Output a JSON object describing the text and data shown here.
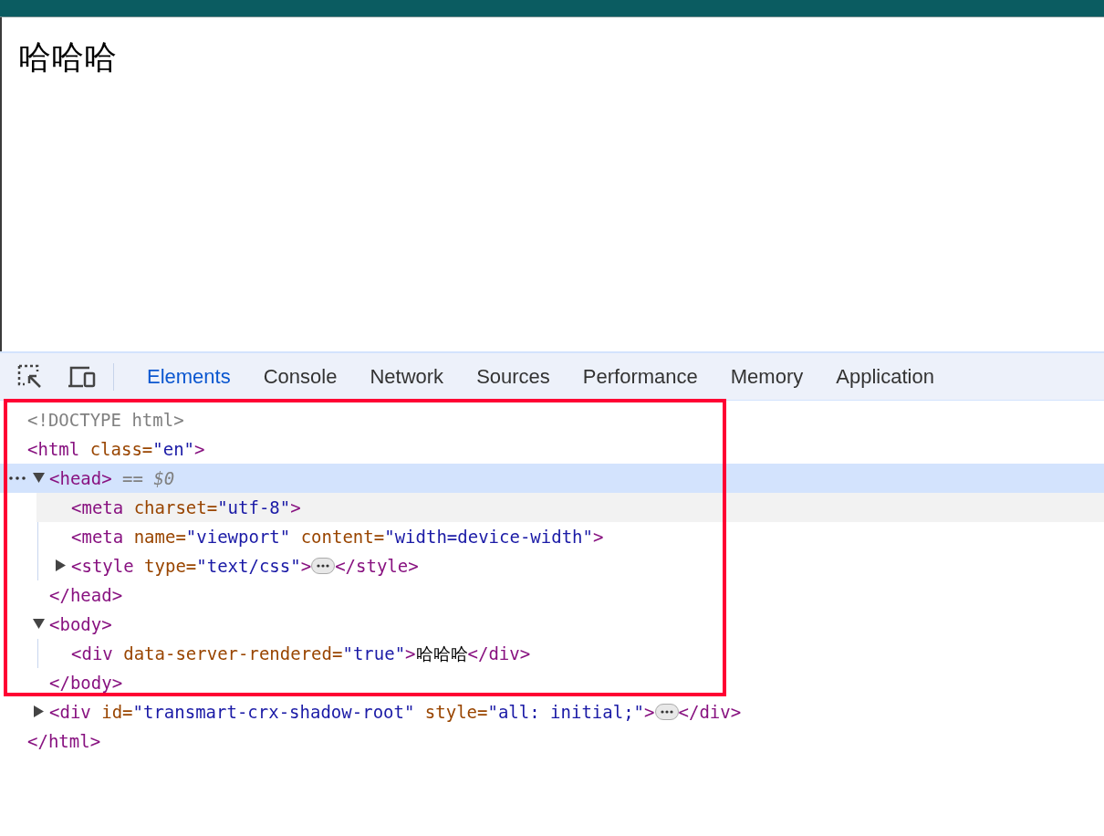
{
  "page": {
    "heading": "哈哈哈"
  },
  "devtools": {
    "tabs": [
      {
        "label": "Elements",
        "selected": true
      },
      {
        "label": "Console",
        "selected": false
      },
      {
        "label": "Network",
        "selected": false
      },
      {
        "label": "Sources",
        "selected": false
      },
      {
        "label": "Performance",
        "selected": false
      },
      {
        "label": "Memory",
        "selected": false
      },
      {
        "label": "Application",
        "selected": false
      }
    ],
    "tree": [
      {
        "selected": false,
        "hovered": false,
        "tokens": [
          {
            "kind": "doctype",
            "text": "<!DOCTYPE html>"
          }
        ]
      },
      {
        "selected": false,
        "hovered": false,
        "tokens": [
          {
            "kind": "tag",
            "text": "<html"
          },
          {
            "kind": "attr",
            "text": " class="
          },
          {
            "kind": "value",
            "text": "\"en\""
          },
          {
            "kind": "tag",
            "text": ">"
          }
        ],
        "closing": [
          {
            "kind": "tag",
            "text": "</html>"
          }
        ],
        "children": [
          {
            "selected": true,
            "hovered": false,
            "expanded": true,
            "tokens": [
              {
                "kind": "tag",
                "text": "<head>"
              },
              {
                "kind": "marker",
                "text": " == $0"
              }
            ],
            "closing": [
              {
                "kind": "tag",
                "text": "</head>"
              }
            ],
            "children": [
              {
                "selected": false,
                "hovered": true,
                "tokens": [
                  {
                    "kind": "tag",
                    "text": "<meta"
                  },
                  {
                    "kind": "attr",
                    "text": " charset="
                  },
                  {
                    "kind": "value",
                    "text": "\"utf-8\""
                  },
                  {
                    "kind": "tag",
                    "text": ">"
                  }
                ]
              },
              {
                "selected": false,
                "hovered": false,
                "tokens": [
                  {
                    "kind": "tag",
                    "text": "<meta"
                  },
                  {
                    "kind": "attr",
                    "text": " name="
                  },
                  {
                    "kind": "value",
                    "text": "\"viewport\""
                  },
                  {
                    "kind": "attr",
                    "text": " content="
                  },
                  {
                    "kind": "value",
                    "text": "\"width=device-width\""
                  },
                  {
                    "kind": "tag",
                    "text": ">"
                  }
                ]
              },
              {
                "selected": false,
                "hovered": false,
                "expanded": false,
                "tokens": [
                  {
                    "kind": "tag",
                    "text": "<style"
                  },
                  {
                    "kind": "attr",
                    "text": " type="
                  },
                  {
                    "kind": "value",
                    "text": "\"text/css\""
                  },
                  {
                    "kind": "tag",
                    "text": ">"
                  },
                  {
                    "kind": "ellipsis"
                  },
                  {
                    "kind": "tag",
                    "text": "</style>"
                  }
                ]
              }
            ]
          },
          {
            "selected": false,
            "hovered": false,
            "expanded": true,
            "tokens": [
              {
                "kind": "tag",
                "text": "<body>"
              }
            ],
            "closing": [
              {
                "kind": "tag",
                "text": "</body>"
              }
            ],
            "children": [
              {
                "selected": false,
                "hovered": false,
                "tokens": [
                  {
                    "kind": "tag",
                    "text": "<div"
                  },
                  {
                    "kind": "attr",
                    "text": " data-server-rendered="
                  },
                  {
                    "kind": "value",
                    "text": "\"true\""
                  },
                  {
                    "kind": "tag",
                    "text": ">"
                  },
                  {
                    "kind": "text",
                    "text": "哈哈哈"
                  },
                  {
                    "kind": "tag",
                    "text": "</div>"
                  }
                ]
              }
            ]
          },
          {
            "selected": false,
            "hovered": false,
            "expanded": false,
            "tokens": [
              {
                "kind": "tag",
                "text": "<div"
              },
              {
                "kind": "attr",
                "text": " id="
              },
              {
                "kind": "value",
                "text": "\"transmart-crx-shadow-root\""
              },
              {
                "kind": "attr",
                "text": " style="
              },
              {
                "kind": "value",
                "text": "\"all: initial;\""
              },
              {
                "kind": "tag",
                "text": ">"
              },
              {
                "kind": "ellipsis"
              },
              {
                "kind": "tag",
                "text": "</div>"
              }
            ]
          }
        ]
      }
    ]
  }
}
